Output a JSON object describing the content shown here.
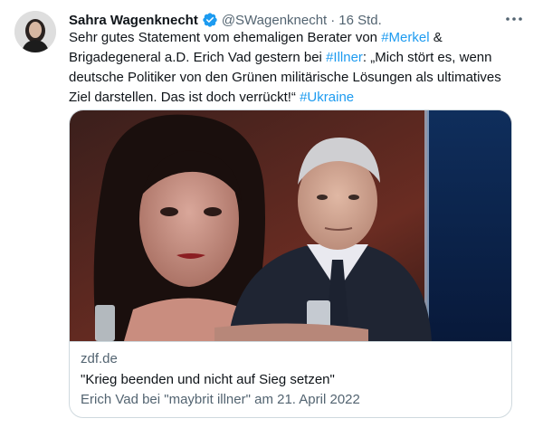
{
  "tweet": {
    "author_name": "Sahra Wagenknecht",
    "handle": "@SWagenknecht",
    "separator": "·",
    "time": "16 Std.",
    "body": [
      {
        "text": "Sehr gutes Statement vom ehemaligen Berater von ",
        "type": "text"
      },
      {
        "text": "#Merkel",
        "type": "hashtag"
      },
      {
        "text": " & Brigadegeneral a.D. Erich Vad gestern bei ",
        "type": "text"
      },
      {
        "text": "#Illner",
        "type": "hashtag"
      },
      {
        "text": ": „Mich stört es, wenn deutsche Politiker von den Grünen militärische Lösungen als ultimatives Ziel darstellen. Das ist doch verrückt!“ ",
        "type": "text"
      },
      {
        "text": "#Ukraine",
        "type": "hashtag"
      }
    ]
  },
  "card": {
    "domain": "zdf.de",
    "title": "\"Krieg beenden und nicht auf Sieg setzen\"",
    "description": "Erich Vad bei \"maybrit illner\" am 21. April 2022"
  },
  "icons": {
    "verified": "verified-badge-icon",
    "more": "more-options-icon"
  },
  "colors": {
    "accent": "#1d9bf0",
    "secondary_text": "#536471",
    "border": "#cfd9de"
  }
}
